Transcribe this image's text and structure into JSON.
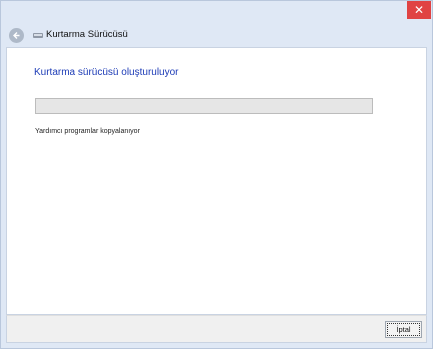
{
  "window": {
    "title": "Kurtarma Sürücüsü",
    "close_glyph": "✕",
    "app_icon": "drive-icon",
    "back_icon": "back-arrow-icon"
  },
  "main": {
    "heading": "Kurtarma sürücüsü oluşturuluyor",
    "progress": 0,
    "status": "Yardımcı programlar kopyalanıyor"
  },
  "footer": {
    "cancel_label": "İptal"
  },
  "colors": {
    "heading": "#1c3bb6",
    "close_button": "#e04343",
    "chrome": "#dfe8f5"
  }
}
